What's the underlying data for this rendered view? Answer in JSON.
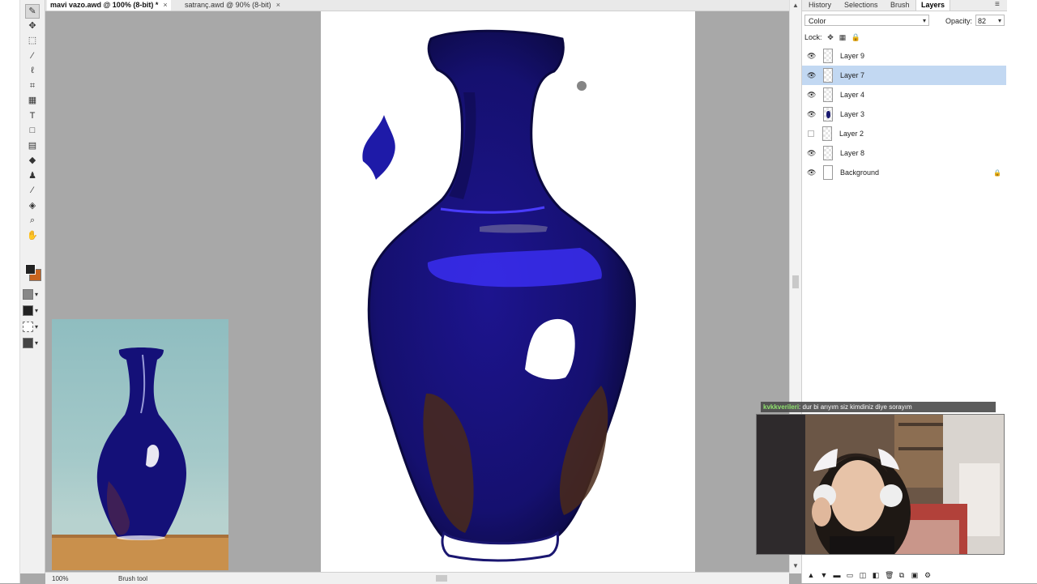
{
  "tabs": [
    {
      "label": "mavi vazo.awd @ 100% (8-bit) *",
      "close": "×"
    },
    {
      "label": "satranç.awd @ 90% (8-bit)",
      "close": "×"
    }
  ],
  "panel": {
    "tabs": [
      "History",
      "Selections",
      "Brush",
      "Layers"
    ],
    "active_tab": "Layers",
    "blend_mode": "Color",
    "opacity_label": "Opacity:",
    "opacity_value": "82",
    "lock_label": "Lock:",
    "layers": [
      {
        "name": "Layer 9",
        "visible": true,
        "selected": false
      },
      {
        "name": "Layer 7",
        "visible": true,
        "selected": true
      },
      {
        "name": "Layer 4",
        "visible": true,
        "selected": false
      },
      {
        "name": "Layer 3",
        "visible": true,
        "selected": false
      },
      {
        "name": "Layer 2",
        "visible": false,
        "selected": false
      },
      {
        "name": "Layer 8",
        "visible": true,
        "selected": false
      },
      {
        "name": "Background",
        "visible": true,
        "selected": false,
        "locked": true
      }
    ]
  },
  "status": {
    "zoom": "100%",
    "tool": "Brush tool"
  },
  "chat": {
    "user": "kvkkverileri",
    "message": ": dur bi arıyım siz kimdiniz diye sorayım"
  },
  "colors": {
    "foreground": "#222222",
    "background": "#c8641e",
    "vase_blue": "#16107a",
    "selection": "#c2d8f2"
  },
  "tools": [
    "brush-icon",
    "move-icon",
    "rect-select-icon",
    "magic-wand-icon",
    "lasso-icon",
    "crop-icon",
    "grid-icon",
    "text-icon",
    "shape-icon",
    "gradient-icon",
    "eraser-icon",
    "clone-stamp-icon",
    "eyedropper-icon",
    "fill-icon",
    "zoom-icon",
    "hand-icon"
  ]
}
